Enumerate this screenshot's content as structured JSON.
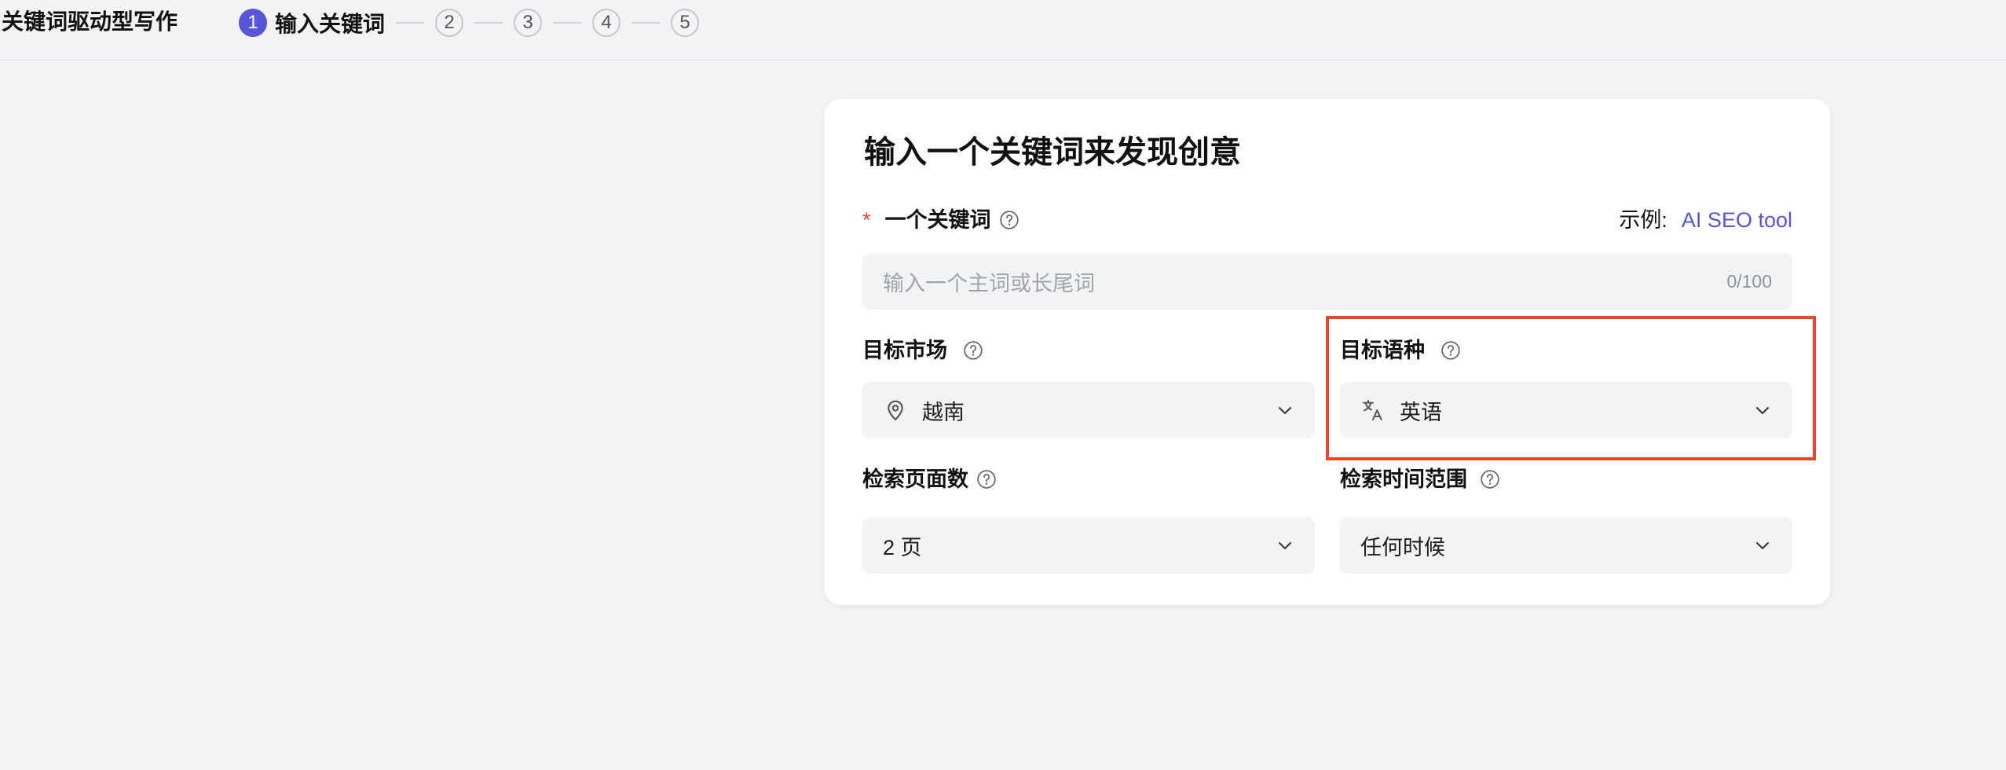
{
  "app": {
    "title": "关键词驱动型写作"
  },
  "steps": [
    {
      "number": "1",
      "label": "输入关键词",
      "active": true
    },
    {
      "number": "2",
      "label": "",
      "active": false
    },
    {
      "number": "3",
      "label": "",
      "active": false
    },
    {
      "number": "4",
      "label": "",
      "active": false
    },
    {
      "number": "5",
      "label": "",
      "active": false
    }
  ],
  "card": {
    "title": "输入一个关键词来发现创意",
    "keyword": {
      "required_mark": "*",
      "label": "一个关键词",
      "example_prefix": "示例:",
      "example_link": "AI SEO tool",
      "placeholder": "输入一个主词或长尾词",
      "counter": "0/100"
    },
    "market": {
      "label": "目标市场",
      "value": "越南",
      "icon": "location-pin-icon"
    },
    "language": {
      "label": "目标语种",
      "value": "英语",
      "icon": "translate-icon"
    },
    "pages": {
      "label": "检索页面数",
      "value": "2 页"
    },
    "time_range": {
      "label": "检索时间范围",
      "value": "任何时候"
    }
  },
  "colors": {
    "accent": "#5855d6",
    "link": "#5755d6",
    "required": "#e5483b",
    "highlight": "#e8452b",
    "background": "#f2f3f5",
    "card": "#ffffff"
  }
}
